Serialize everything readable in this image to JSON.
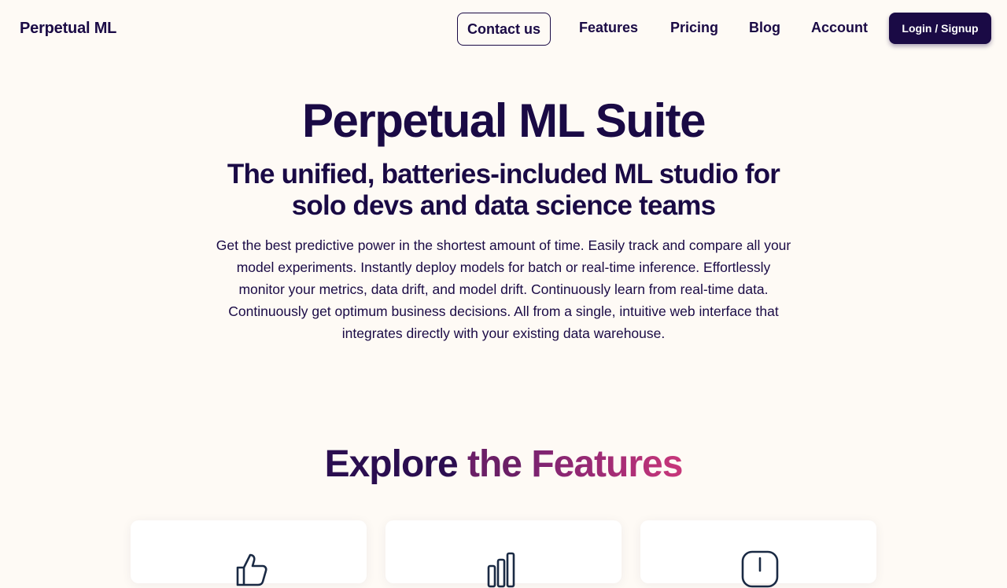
{
  "nav": {
    "brand": "Perpetual ML",
    "contact_label": "Contact us",
    "links": [
      "Features",
      "Pricing",
      "Blog",
      "Account"
    ],
    "login_label": "Login / Signup"
  },
  "hero": {
    "title": "Perpetual ML Suite",
    "subtitle_line1": "The unified, batteries-included ML studio for",
    "subtitle_line2": "solo devs and data science teams",
    "desc_lines": [
      "Get the best predictive power in the shortest amount of time. Easily track and compare all your",
      "model experiments. Instantly deploy models for batch or real-time inference. Effortlessly",
      "monitor your metrics, data drift, and model drift. Continuously learn from real-time data.",
      "Continuously get optimum business decisions. All from a single, intuitive web interface that",
      "integrates directly with your existing data warehouse."
    ]
  },
  "features": {
    "title_w1": "Explore",
    "title_w2": "the",
    "title_w3": "Features",
    "cards": [
      {
        "icon": "thumbs-up-icon"
      },
      {
        "icon": "bar-chart-icon"
      },
      {
        "icon": "clock-icon"
      }
    ]
  },
  "colors": {
    "background": "#fefaf5",
    "primary": "#1a0a45",
    "gradient_start": "#2b0e50",
    "gradient_end": "#c8367a"
  }
}
